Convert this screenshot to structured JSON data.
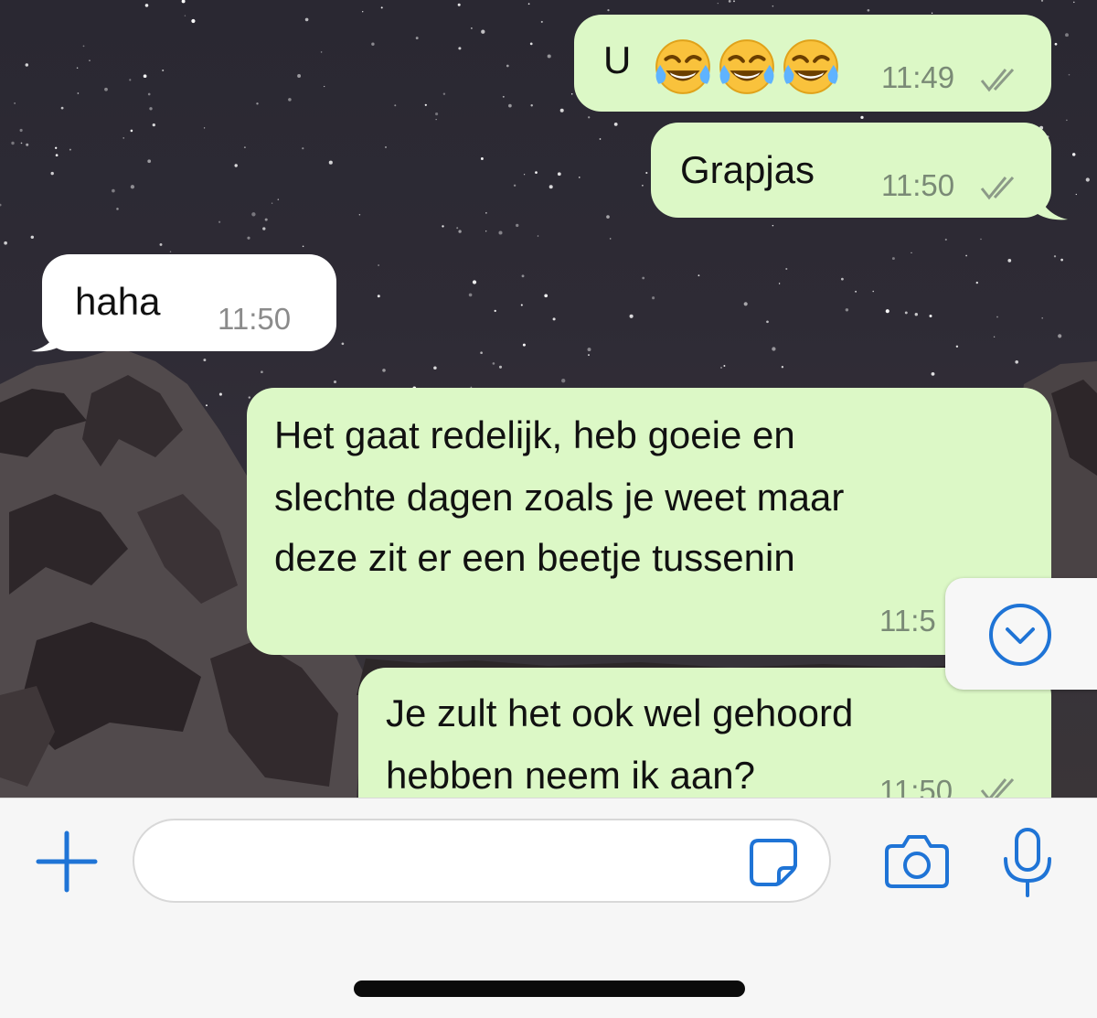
{
  "messages": [
    {
      "direction": "outgoing",
      "text": "U",
      "emoji": "face-with-tears-of-joy",
      "emoji_count": 3,
      "time": "11:49",
      "status": "read"
    },
    {
      "direction": "outgoing",
      "text": "Grapjas",
      "time": "11:50",
      "status": "read"
    },
    {
      "direction": "incoming",
      "text": "haha",
      "time": "11:50"
    },
    {
      "direction": "outgoing",
      "lines": [
        "Het gaat redelijk, heb goeie en",
        "slechte dagen zoals je weet maar",
        "deze zit er een beetje tussenin"
      ],
      "time": "11:5",
      "status": "read"
    },
    {
      "direction": "outgoing",
      "lines": [
        "Je zult het ook wel gehoord",
        "hebben neem ik aan?"
      ],
      "time": "11:50",
      "status": "read"
    }
  ],
  "composer": {
    "placeholder": ""
  },
  "icons": {
    "add": "plus-icon",
    "sticker": "sticker-icon",
    "camera": "camera-icon",
    "microphone": "microphone-icon",
    "scroll_down": "chevron-down-circle-icon"
  },
  "colors": {
    "outgoing_bubble": "#dcf8c6",
    "incoming_bubble": "#ffffff",
    "accent": "#1f74d6",
    "timestamp": "#7a8a76"
  }
}
